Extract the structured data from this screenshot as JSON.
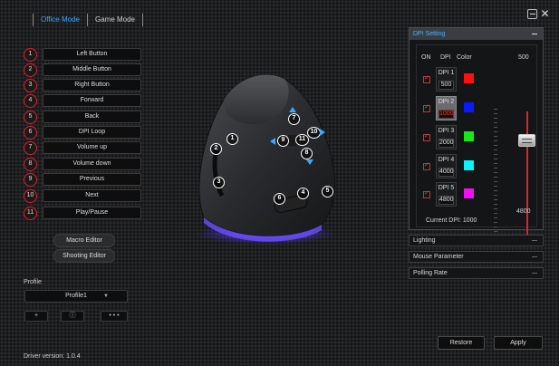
{
  "header": {
    "tabs": [
      {
        "label": "Office Mode",
        "active": true
      },
      {
        "label": "Game Mode",
        "active": false
      }
    ]
  },
  "buttons": [
    {
      "num": "1",
      "label": "Left Button"
    },
    {
      "num": "2",
      "label": "Middle Button"
    },
    {
      "num": "3",
      "label": "Right Button"
    },
    {
      "num": "4",
      "label": "Forward"
    },
    {
      "num": "5",
      "label": "Back"
    },
    {
      "num": "6",
      "label": "DPI Loop"
    },
    {
      "num": "7",
      "label": "Volume up"
    },
    {
      "num": "8",
      "label": "Volume down"
    },
    {
      "num": "9",
      "label": "Previous"
    },
    {
      "num": "10",
      "label": "Next"
    },
    {
      "num": "11",
      "label": "Play/Pause"
    }
  ],
  "editors": {
    "macro": "Macro Editor",
    "shooting": "Shooting Editor"
  },
  "profile": {
    "label": "Profile",
    "selected": "Profile1",
    "tools": [
      "+",
      "ⓘ",
      "• • •"
    ]
  },
  "dpi_setting": {
    "title": "DPI Setting",
    "columns": {
      "on": "ON",
      "dpi": "DPI",
      "color": "Color"
    },
    "stages": [
      {
        "name": "DPI 1",
        "value": "500",
        "color": "#ff1010",
        "selected": false
      },
      {
        "name": "DPI 2",
        "value": "1000",
        "color": "#0a1aff",
        "selected": true
      },
      {
        "name": "DPI 3",
        "value": "2000",
        "color": "#18e818",
        "selected": false
      },
      {
        "name": "DPI 4",
        "value": "4000",
        "color": "#10f0f8",
        "selected": false
      },
      {
        "name": "DPI 5",
        "value": "4800",
        "color": "#f010f0",
        "selected": false
      }
    ],
    "slider_max": "500",
    "slider_min": "4800",
    "current_label": "Current DPI:",
    "current_value": "1000"
  },
  "panels": {
    "lighting": "Lighting",
    "mouse_parameter": "Mouse Parameter",
    "polling_rate": "Polling Rate"
  },
  "actions": {
    "restore": "Restore",
    "apply": "Apply"
  },
  "footer": {
    "driver_version": "Driver version: 1.0.4"
  },
  "mouse_callouts": [
    "1",
    "2",
    "3",
    "4",
    "5",
    "6",
    "7",
    "8",
    "9",
    "10",
    "11"
  ],
  "colors": {
    "accent_blue": "#3ea7ff",
    "accent_red": "#e0202a"
  }
}
